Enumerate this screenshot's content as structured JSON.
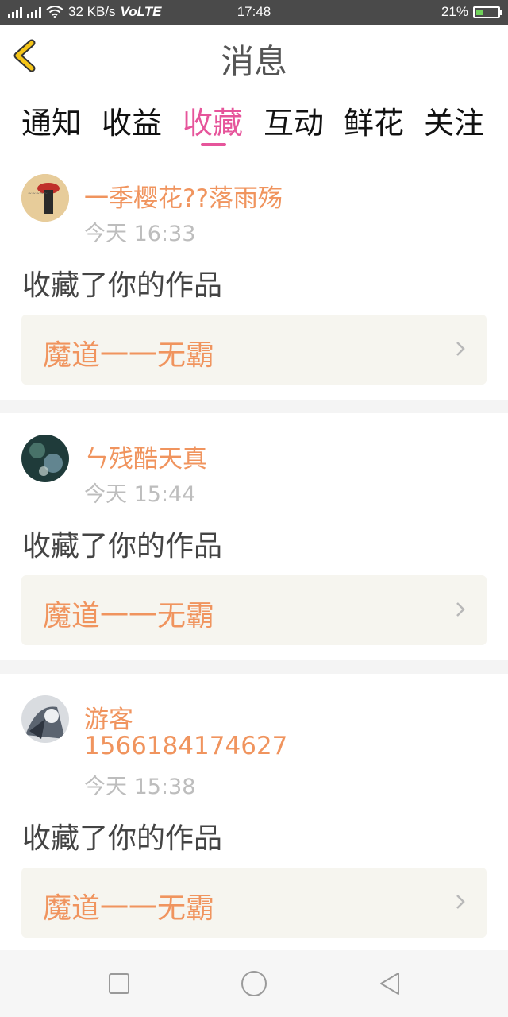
{
  "status_bar": {
    "net_2g": "2G",
    "net_4g": "4G",
    "speed": "32 KB/s",
    "volte": "VoLTE",
    "time": "17:48",
    "battery": "21%",
    "battery_level": 0.21
  },
  "header": {
    "title": "消息",
    "back_icon": "chevron-left-icon",
    "accent_color": "#f5c518"
  },
  "tabs": [
    {
      "label": "通知",
      "active": false
    },
    {
      "label": "收益",
      "active": false
    },
    {
      "label": "收藏",
      "active": true
    },
    {
      "label": "互动",
      "active": false
    },
    {
      "label": "鲜花",
      "active": false
    },
    {
      "label": "关注",
      "active": false
    }
  ],
  "active_tab_color": "#e6559b",
  "messages": [
    {
      "username": "一季樱花??落雨殇",
      "time": "今天 16:33",
      "action": "收藏了你的作品",
      "work_title": "魔道一一无霸"
    },
    {
      "username": "ㄣ残酷天真",
      "time": "今天 15:44",
      "action": "收藏了你的作品",
      "work_title": "魔道一一无霸"
    },
    {
      "username": "游客",
      "username_line2": "1566184174627",
      "time": "今天 15:38",
      "action": "收藏了你的作品",
      "work_title": "魔道一一无霸"
    }
  ],
  "nav_bar": {
    "recents_icon": "square-icon",
    "home_icon": "circle-icon",
    "back_icon": "triangle-back-icon"
  }
}
